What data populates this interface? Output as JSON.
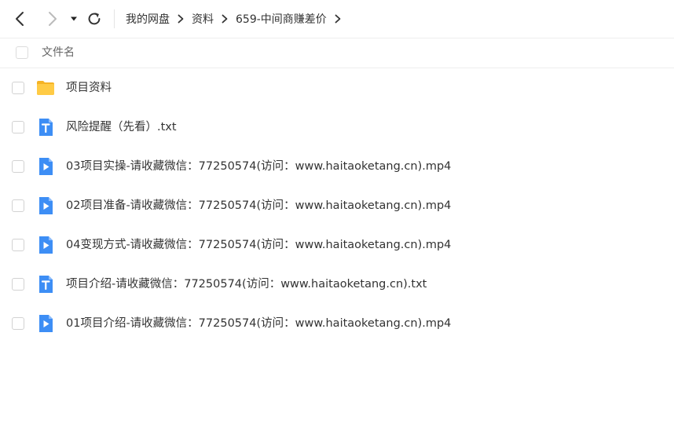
{
  "toolbar": {
    "back_icon": "chevron-left-icon",
    "forward_icon": "chevron-right-icon",
    "dropdown_icon": "caret-down-icon",
    "refresh_icon": "refresh-icon"
  },
  "breadcrumb": [
    {
      "label": "我的网盘"
    },
    {
      "label": "资料"
    },
    {
      "label": "659-中间商赚差价"
    }
  ],
  "list_header": {
    "name_label": "文件名"
  },
  "files": [
    {
      "name": "项目资料",
      "type": "folder"
    },
    {
      "name": "风险提醒（先看）.txt",
      "type": "txt"
    },
    {
      "name": "03项目实操-请收藏微信：77250574(访问：www.haitaoketang.cn).mp4",
      "type": "video"
    },
    {
      "name": "02项目准备-请收藏微信：77250574(访问：www.haitaoketang.cn).mp4",
      "type": "video"
    },
    {
      "name": "04变现方式-请收藏微信：77250574(访问：www.haitaoketang.cn).mp4",
      "type": "video"
    },
    {
      "name": "项目介绍-请收藏微信：77250574(访问：www.haitaoketang.cn).txt",
      "type": "txt"
    },
    {
      "name": "01项目介绍-请收藏微信：77250574(访问：www.haitaoketang.cn).mp4",
      "type": "video"
    }
  ],
  "colors": {
    "folder": "#FFC83D",
    "file_blue": "#3D8EF5",
    "nav_active": "#333333",
    "nav_disabled": "#bbbbbb"
  }
}
